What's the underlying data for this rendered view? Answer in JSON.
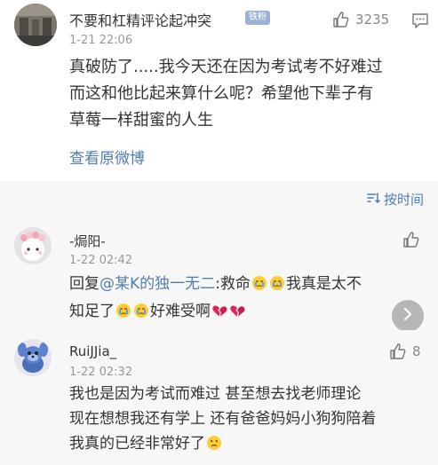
{
  "main_comment": {
    "username": "不要和杠精评论起冲突",
    "badge": "铁粉",
    "timestamp": "1-21 22:06",
    "like_count": "3235",
    "text_lines": [
      "真破防了.....我今天还在因为考试考不好难过",
      "而这和他比起来算什么呢？希望他下辈子有",
      "草莓一样甜蜜的人生"
    ],
    "view_original": "查看原微博"
  },
  "sort": {
    "label": "按时间"
  },
  "replies": [
    {
      "username": "-焗阳-",
      "timestamp": "1-22 02:42",
      "like_count": "",
      "line1_prefix": "回复",
      "mention": "@某K的独一无二",
      "line1_suffix": ":救命",
      "line1_end": "我真是太不",
      "line2_start": "知足了",
      "line2_mid": "好难受啊"
    },
    {
      "username": "RuiJJia_",
      "timestamp": "1-22 02:32",
      "like_count": "8",
      "text_lines": [
        "我也是因为考试而难过 甚至想去找老师理论",
        "现在想想我还有学上 还有爸爸妈妈小狗狗陪着",
        "我真的已经非常好了"
      ]
    }
  ],
  "colors": {
    "link": "#507daf",
    "badge": "#9bb2d6",
    "muted": "#999999",
    "reply_bg": "#f7f7f7"
  },
  "icons": {
    "like": "thumbs-up-icon",
    "comment": "comment-icon",
    "sort": "sort-icon",
    "next": "chevron-right-icon",
    "crying": "crying-face-emoji",
    "broken_heart": "broken-heart-emoji",
    "slight_frown": "frowning-face-emoji"
  }
}
